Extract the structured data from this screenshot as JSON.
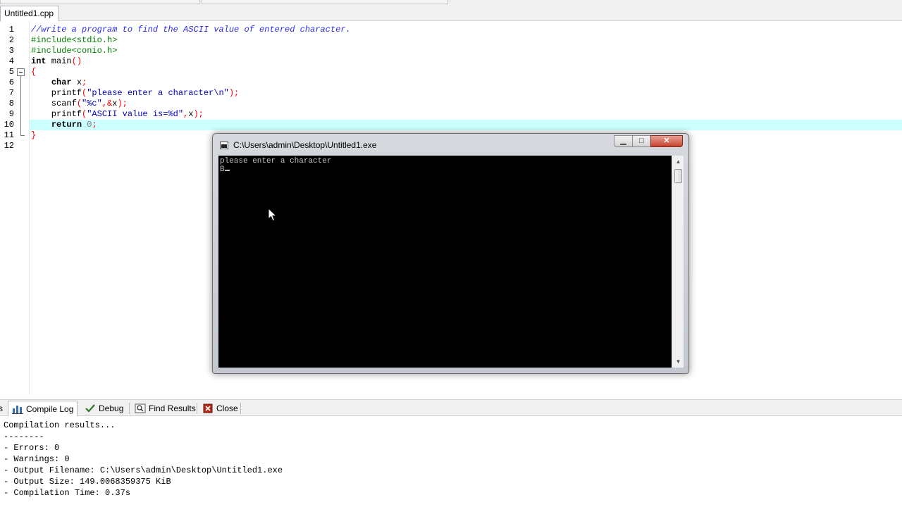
{
  "editor": {
    "file_tab": "Untitled1.cpp",
    "line_numbers": [
      "1",
      "2",
      "3",
      "4",
      "5",
      "6",
      "7",
      "8",
      "9",
      "10",
      "11",
      "12"
    ],
    "lines": [
      {
        "parts": [
          {
            "t": "//write a program to find the ASCII value of entered character.",
            "c": "comment"
          }
        ]
      },
      {
        "parts": [
          {
            "t": "#include<stdio.h>",
            "c": "pre"
          }
        ]
      },
      {
        "parts": [
          {
            "t": "#include<conio.h>",
            "c": "pre"
          }
        ]
      },
      {
        "parts": [
          {
            "t": "int",
            "c": "kw"
          },
          {
            "t": " main",
            "c": ""
          },
          {
            "t": "()",
            "c": "sym"
          }
        ]
      },
      {
        "parts": [
          {
            "t": "{",
            "c": "sym"
          }
        ]
      },
      {
        "parts": [
          {
            "t": "    ",
            "c": ""
          },
          {
            "t": "char",
            "c": "kw"
          },
          {
            "t": " x",
            "c": ""
          },
          {
            "t": ";",
            "c": "sym"
          }
        ]
      },
      {
        "parts": [
          {
            "t": "    printf",
            "c": ""
          },
          {
            "t": "(",
            "c": "sym"
          },
          {
            "t": "\"please enter a character\\n\"",
            "c": "str"
          },
          {
            "t": ");",
            "c": "sym"
          }
        ]
      },
      {
        "parts": [
          {
            "t": "    scanf",
            "c": ""
          },
          {
            "t": "(",
            "c": "sym"
          },
          {
            "t": "\"%c\"",
            "c": "str"
          },
          {
            "t": ",&",
            "c": "sym"
          },
          {
            "t": "x",
            "c": ""
          },
          {
            "t": ");",
            "c": "sym"
          }
        ]
      },
      {
        "parts": [
          {
            "t": "    printf",
            "c": ""
          },
          {
            "t": "(",
            "c": "sym"
          },
          {
            "t": "\"ASCII value is=%d\"",
            "c": "str"
          },
          {
            "t": ",",
            "c": "sym"
          },
          {
            "t": "x",
            "c": ""
          },
          {
            "t": ");",
            "c": "sym"
          }
        ]
      },
      {
        "parts": [
          {
            "t": "    ",
            "c": ""
          },
          {
            "t": "return",
            "c": "kw"
          },
          {
            "t": " ",
            "c": ""
          },
          {
            "t": "0",
            "c": "num"
          },
          {
            "t": ";",
            "c": "sym"
          }
        ]
      },
      {
        "parts": [
          {
            "t": "}",
            "c": "sym"
          }
        ]
      },
      {
        "parts": []
      }
    ],
    "highlighted_line": 10
  },
  "console": {
    "title": "C:\\Users\\admin\\Desktop\\Untitled1.exe",
    "min_label": "▁",
    "max_label": "□",
    "close_label": "✕",
    "output_lines": [
      "please enter a character",
      "B"
    ]
  },
  "panel": {
    "tabs": [
      {
        "label": "s",
        "icon": ""
      },
      {
        "label": "Compile Log",
        "icon": "bar-chart-icon"
      },
      {
        "label": "Debug",
        "icon": "check-icon"
      },
      {
        "label": "Find Results",
        "icon": "find-icon"
      },
      {
        "label": "Close",
        "icon": "close-icon"
      }
    ]
  },
  "compile_log": {
    "lines": [
      "Compilation results...",
      "--------",
      "- Errors: 0",
      "- Warnings: 0",
      "- Output Filename: C:\\Users\\admin\\Desktop\\Untitled1.exe",
      "- Output Size: 149.0068359375 KiB",
      "- Compilation Time: 0.37s"
    ]
  }
}
